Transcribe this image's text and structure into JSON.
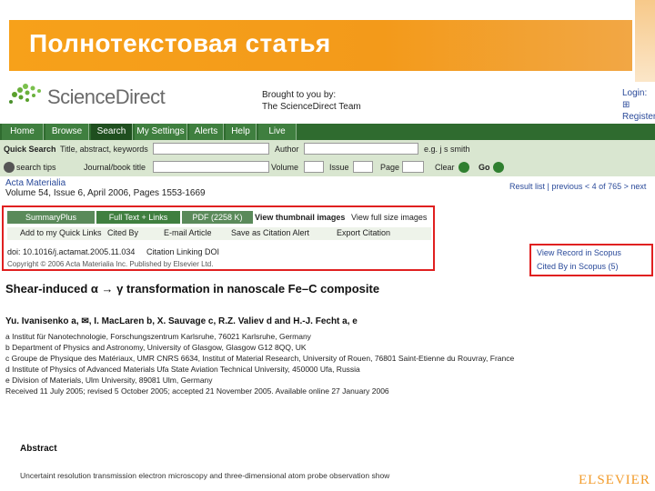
{
  "slide": {
    "title": "Полнотекстовая статья"
  },
  "header": {
    "logo_text": "ScienceDirect",
    "brought_line1": "Brought to you by:",
    "brought_line2": "The ScienceDirect Team",
    "login_line1": "Login: ⊞",
    "login_line2": "Register"
  },
  "nav": {
    "tabs": [
      {
        "label": "Home"
      },
      {
        "label": "Browse"
      },
      {
        "label": "Search"
      },
      {
        "label": "My Settings"
      },
      {
        "label": "Alerts"
      },
      {
        "label": "Help"
      },
      {
        "label": "Live Chat"
      }
    ]
  },
  "quick_search": {
    "title": "Quick Search",
    "field1_label": "Title, abstract, keywords",
    "author_label": "Author",
    "author_hint": "e.g. j s smith",
    "search_tips": "search tips",
    "journal_label": "Journal/book title",
    "volume_label": "Volume",
    "issue_label": "Issue",
    "page_label": "Page",
    "clear_label": "Clear",
    "go_label": "Go"
  },
  "article_meta": {
    "journal": "Acta Materialia",
    "volume_line": "Volume 54, Issue 6, April 2006, Pages 1553-1669",
    "result_nav": "Result list | previous < 4 of 765 > next"
  },
  "article_tabs": {
    "summary_plus": "SummaryPlus",
    "full_text": "Full Text + Links",
    "pdf": "PDF (2258 K)",
    "thumbnails": "View thumbnail images",
    "full_size": "View full size images"
  },
  "actions": {
    "add_quick_links": "Add to my Quick Links",
    "cited_by": "Cited By",
    "email_article": "E-mail Article",
    "save_alert": "Save as Citation Alert",
    "export_citation": "Export Citation"
  },
  "doi_line": "doi: 10.1016/j.actamat.2005.11.034",
  "cited_using": "Citation Linking DOI",
  "copyright_line": "Copyright © 2006 Acta Materialia Inc. Published by Elsevier Ltd.",
  "scopus": {
    "view_record": "View Record in Scopus",
    "cited_by": "Cited By in Scopus (5)"
  },
  "article": {
    "title": "Shear-induced α → γ transformation in nanoscale Fe–C composite",
    "authors": "Yu. Ivanisenko a, ✉, I. MacLaren b, X. Sauvage c, R.Z. Valiev d and H.-J. Fecht a, e",
    "affiliations": [
      "a Institut für Nanotechnologie, Forschungszentrum Karlsruhe, 76021 Karlsruhe, Germany",
      "b Department of Physics and Astronomy, University of Glasgow, Glasgow G12 8QQ, UK",
      "c Groupe de Physique des Matériaux, UMR CNRS 6634, Institut of Material Research, University of Rouen, 76801 Saint-Etienne du Rouvray, France",
      "d Institute of Physics of Advanced Materials  Ufa State Aviation Technical University, 450000  Ufa, Russia",
      "e Division of Materials, Ulm University, 89081 Ulm, Germany",
      "Received 11 July 2005;  revised 5 October 2005;  accepted 21 November 2005.  Available online 27 January 2006"
    ],
    "abstract_heading": "Abstract",
    "abstract_start": "Uncertaint resolution transmission electron microscopy and three-dimensional atom probe observation show"
  },
  "publisher": "ELSEVIER",
  "colors": {
    "accent": "#f7a11a",
    "nav": "#2f6b2f",
    "highlight": "#e02020",
    "link": "#2a4a9a"
  }
}
